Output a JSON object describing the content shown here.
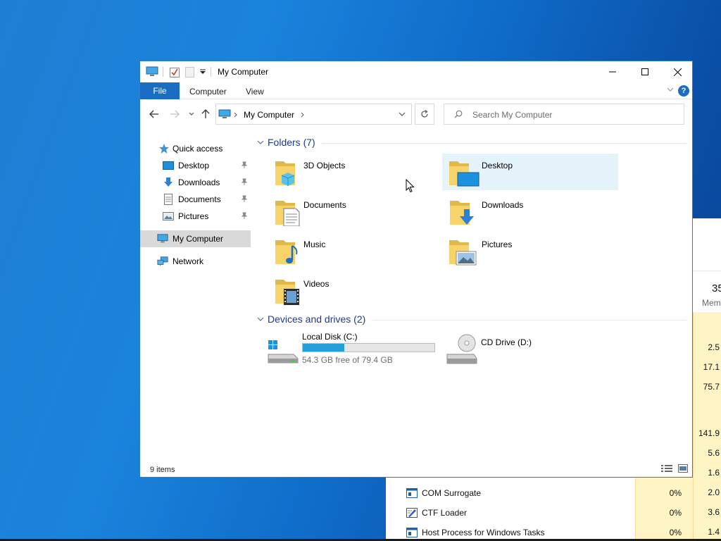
{
  "explorer": {
    "title": "My Computer",
    "tabs": {
      "file": "File",
      "computer": "Computer",
      "view": "View"
    },
    "help": "?",
    "address": {
      "path": "My Computer"
    },
    "search": {
      "placeholder": "Search My Computer"
    },
    "nav": {
      "quick_access": "Quick access",
      "desktop": "Desktop",
      "downloads": "Downloads",
      "documents": "Documents",
      "pictures": "Pictures",
      "my_computer": "My Computer",
      "network": "Network"
    },
    "folders_group": "Folders (7)",
    "folders": [
      {
        "label": "3D Objects",
        "icon": "3d-objects-folder-icon"
      },
      {
        "label": "Desktop",
        "icon": "desktop-folder-icon"
      },
      {
        "label": "Documents",
        "icon": "documents-folder-icon"
      },
      {
        "label": "Downloads",
        "icon": "downloads-folder-icon"
      },
      {
        "label": "Music",
        "icon": "music-folder-icon"
      },
      {
        "label": "Pictures",
        "icon": "pictures-folder-icon"
      },
      {
        "label": "Videos",
        "icon": "videos-folder-icon"
      }
    ],
    "devices_group": "Devices and drives (2)",
    "drives": [
      {
        "label": "Local Disk (C:)",
        "free_text": "54.3 GB free of 79.4 GB",
        "used_fraction": 0.316
      },
      {
        "label": "CD Drive (D:)"
      }
    ],
    "status": "9 items",
    "colors": {
      "accent": "#1a6dc2",
      "selection": "#e5f3fb",
      "group_title": "#1e3a8a",
      "progress": "#26a0da"
    }
  },
  "task_manager": {
    "memory_header_value": "35",
    "memory_header_label": "Mem",
    "memory_values": [
      "2.5",
      "17.1",
      "75.7",
      "141.9",
      "5.6",
      "1.6",
      "2.0",
      "3.6",
      "1.4"
    ],
    "processes": [
      {
        "name": "COM Surrogate",
        "cpu": "0%"
      },
      {
        "name": "CTF Loader",
        "cpu": "0%"
      },
      {
        "name": "Host Process for Windows Tasks",
        "cpu": "0%"
      }
    ]
  }
}
